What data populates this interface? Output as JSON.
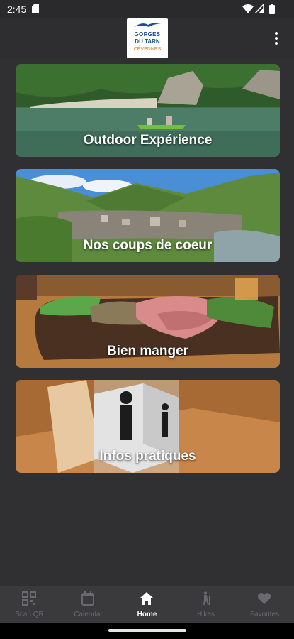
{
  "status_bar": {
    "time": "2:45"
  },
  "header": {
    "logo": {
      "line1": "GORGES",
      "line2": "DU TARN",
      "line3": "CÉVENNES"
    }
  },
  "cards": [
    {
      "label": "Outdoor Expérience"
    },
    {
      "label": "Nos coups de coeur"
    },
    {
      "label": "Bien manger"
    },
    {
      "label": "Infos pratiques"
    }
  ],
  "bottom_nav": {
    "items": [
      {
        "label": "Scan QR",
        "icon": "qr-code-icon"
      },
      {
        "label": "Calendar",
        "icon": "calendar-icon"
      },
      {
        "label": "Home",
        "icon": "home-icon",
        "active": true
      },
      {
        "label": "Hikes",
        "icon": "hiker-icon"
      },
      {
        "label": "Favorites",
        "icon": "heart-icon"
      }
    ]
  },
  "colors": {
    "background": "#303033",
    "nav_background": "#3a3a3d",
    "logo_blue": "#1d4d8a",
    "logo_orange": "#e07b21"
  }
}
